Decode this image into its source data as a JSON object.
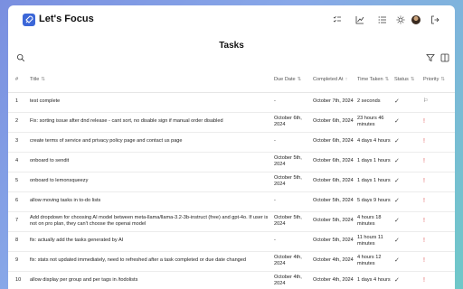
{
  "app": {
    "title": "Let's Focus"
  },
  "page": {
    "title": "Tasks"
  },
  "nav": [
    "list-check-icon",
    "chart-icon",
    "list-icon",
    "sun-icon",
    "avatar",
    "logout-icon"
  ],
  "columns": {
    "num": "#",
    "title": "Title",
    "due": "Due Date",
    "completed": "Completed At",
    "taken": "Time Taken",
    "status": "Status",
    "priority": "Priority"
  },
  "rows": [
    {
      "num": "1",
      "title": "test complete",
      "due": "-",
      "completed": "October 7th, 2024",
      "taken": "2 seconds",
      "priority": "flag"
    },
    {
      "num": "2",
      "title": "Fix: sorting issue after dnd release - cant sort, no disable sign if manual order disabled",
      "due": "October 6th, 2024",
      "completed": "October 6th, 2024",
      "taken": "23 hours 46 minutes",
      "priority": "high"
    },
    {
      "num": "3",
      "title": "create terms of service and privacy policy page and contact us page",
      "due": "-",
      "completed": "October 6th, 2024",
      "taken": "4 days 4 hours",
      "priority": "high"
    },
    {
      "num": "4",
      "title": "onboard to sendit",
      "due": "October 5th, 2024",
      "completed": "October 6th, 2024",
      "taken": "1 days 1 hours",
      "priority": "high"
    },
    {
      "num": "5",
      "title": "onboard to lemonsqueezy",
      "due": "October 5th, 2024",
      "completed": "October 6th, 2024",
      "taken": "1 days 1 hours",
      "priority": "high"
    },
    {
      "num": "6",
      "title": "allow moving tasks in to-do lists",
      "due": "-",
      "completed": "October 5th, 2024",
      "taken": "5 days 9 hours",
      "priority": "high"
    },
    {
      "num": "7",
      "title": "Add dropdown for choosing AI model between meta-llama/llama-3.2-3b-instruct (free) and gpt-4o. If user is not on pro plan, they can't choose the openai model",
      "due": "October 5th, 2024",
      "completed": "October 5th, 2024",
      "taken": "4 hours 18 minutes",
      "priority": "high"
    },
    {
      "num": "8",
      "title": "fix: actually add the tasks generated by AI",
      "due": "-",
      "completed": "October 5th, 2024",
      "taken": "11 hours 11 minutes",
      "priority": "high"
    },
    {
      "num": "9",
      "title": "fix: stats not updated immediately, need to refreshed after a task completed or due date changed",
      "due": "October 4th, 2024",
      "completed": "October 4th, 2024",
      "taken": "4 hours 12 minutes",
      "priority": "high"
    },
    {
      "num": "10",
      "title": "allow display per group and per tags in /todolists",
      "due": "October 4th, 2024",
      "completed": "October 4th, 2024",
      "taken": "1 days 4 hours",
      "priority": "high"
    }
  ],
  "colors": {
    "accent": "#3c67d8",
    "priority_high": "#e05a5a"
  }
}
